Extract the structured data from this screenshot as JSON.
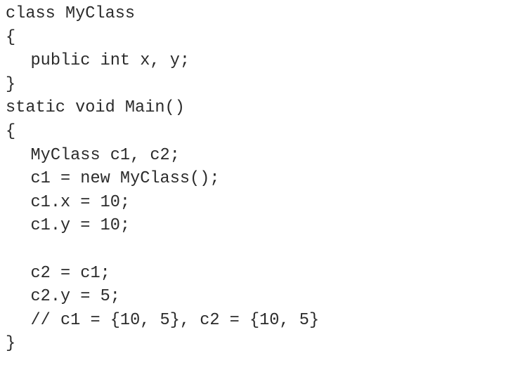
{
  "code": {
    "language": "C#",
    "text_color": "#2b2b2b",
    "lines": [
      {
        "indent": 0,
        "text": "class MyClass"
      },
      {
        "indent": 0,
        "text": "{"
      },
      {
        "indent": 1,
        "text": "public int x, y;"
      },
      {
        "indent": 0,
        "text": "}"
      },
      {
        "indent": 0,
        "text": "static void Main()"
      },
      {
        "indent": 0,
        "text": "{"
      },
      {
        "indent": 1,
        "text": "MyClass c1, c2;"
      },
      {
        "indent": 1,
        "text": "c1 = new MyClass();"
      },
      {
        "indent": 1,
        "text": "c1.x = 10;"
      },
      {
        "indent": 1,
        "text": "c1.y = 10;"
      },
      {
        "indent": 1,
        "text": ""
      },
      {
        "indent": 1,
        "text": "c2 = c1;"
      },
      {
        "indent": 1,
        "text": "c2.y = 5;"
      },
      {
        "indent": 1,
        "text": "// c1 = {10, 5}, c2 = {10, 5}"
      },
      {
        "indent": 0,
        "text": "}"
      }
    ]
  }
}
